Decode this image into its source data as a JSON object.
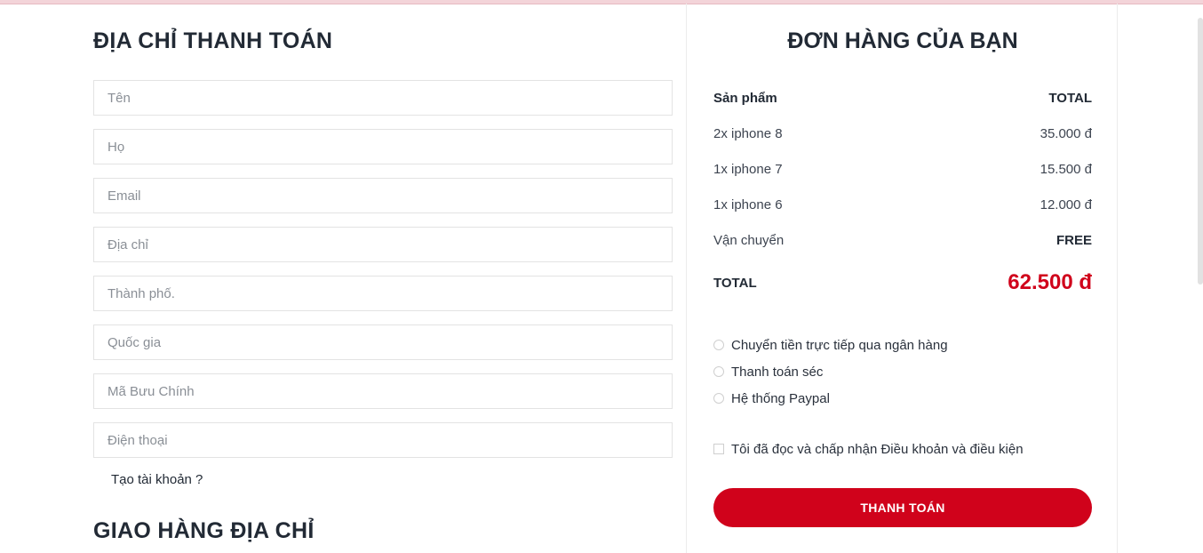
{
  "billing": {
    "title": "ĐỊA CHỈ THANH TOÁN",
    "fields": [
      {
        "placeholder": "Tên"
      },
      {
        "placeholder": "Họ"
      },
      {
        "placeholder": "Email"
      },
      {
        "placeholder": "Địa chỉ"
      },
      {
        "placeholder": "Thành phố."
      },
      {
        "placeholder": "Quốc gia"
      },
      {
        "placeholder": "Mã Bưu Chính"
      },
      {
        "placeholder": "Điện thoại"
      }
    ],
    "create_account": "Tạo tài khoản ?"
  },
  "shipping": {
    "title": "GIAO HÀNG ĐỊA CHỈ"
  },
  "order": {
    "title": "ĐƠN HÀNG CỦA BẠN",
    "header": {
      "product": "Sản phẩm",
      "total": "TOTAL"
    },
    "items": [
      {
        "name": "2x iphone 8",
        "price": "35.000 đ"
      },
      {
        "name": "1x iphone 7",
        "price": "15.500 đ"
      },
      {
        "name": "1x iphone 6",
        "price": "12.000 đ"
      }
    ],
    "shipping": {
      "label": "Vận chuyển",
      "value": "FREE"
    },
    "total": {
      "label": "TOTAL",
      "value": "62.500 đ"
    },
    "payment_methods": [
      {
        "label": "Chuyển tiền trực tiếp qua ngân hàng"
      },
      {
        "label": "Thanh toán séc"
      },
      {
        "label": "Hệ thống Paypal"
      }
    ],
    "terms_label": "Tôi đã đọc và chấp nhận Điều khoản và điều kiện",
    "pay_button": "THANH TOÁN"
  },
  "colors": {
    "accent": "#d0021b",
    "text": "#222a35",
    "border": "#e3e3e3"
  }
}
